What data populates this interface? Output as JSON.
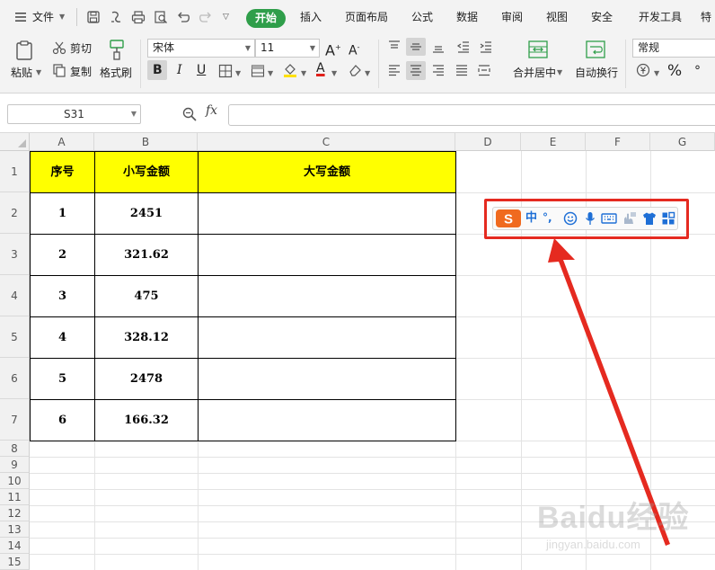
{
  "menu": {
    "file": "文件",
    "tabs": [
      "开始",
      "插入",
      "页面布局",
      "公式",
      "数据",
      "审阅",
      "视图",
      "安全",
      "开发工具",
      "特"
    ]
  },
  "ribbon": {
    "paste": "粘贴",
    "cut": "剪切",
    "copy": "复制",
    "format_painter": "格式刷",
    "font_name": "宋体",
    "font_size": "11",
    "bold": "B",
    "italic": "I",
    "underline": "U",
    "font_color_letter": "A",
    "grow_font": "A",
    "shrink_font": "A",
    "merge_center": "合并居中",
    "wrap_text": "自动换行",
    "number_format": "常规",
    "percent": "%",
    "more": "°",
    "font_color_hex": "#e0201a",
    "fill_color_hex": "#ffe000"
  },
  "formula_bar": {
    "cell_ref": "S31",
    "fx": "fx",
    "value": ""
  },
  "sheet": {
    "columns": [
      "A",
      "B",
      "C",
      "D",
      "E",
      "F",
      "G"
    ],
    "rows": [
      "1",
      "2",
      "3",
      "4",
      "5",
      "6",
      "7",
      "8",
      "9",
      "10",
      "11",
      "12",
      "13",
      "14",
      "15"
    ],
    "table_header": [
      "序号",
      "小写金额",
      "大写金额"
    ],
    "table_rows": [
      [
        "1",
        "2451",
        ""
      ],
      [
        "2",
        "321.62",
        ""
      ],
      [
        "3",
        "475",
        ""
      ],
      [
        "4",
        "328.12",
        ""
      ],
      [
        "5",
        "2478",
        ""
      ],
      [
        "6",
        "166.32",
        ""
      ]
    ],
    "header_fill": "#ffff00"
  },
  "ime_toolbar": {
    "logo": "S",
    "mode": "中",
    "punct": "°,",
    "icons": [
      "sogou-logo-icon",
      "chinese-mode-icon",
      "punctuation-icon",
      "emoji-icon",
      "microphone-icon",
      "keyboard-icon",
      "handwriting-icon",
      "skin-shirt-icon",
      "toolbox-grid-icon"
    ],
    "highlight_color": "#e52a20"
  },
  "watermark": {
    "main": "Baidu经验",
    "sub": "jingyan.baidu.com"
  }
}
